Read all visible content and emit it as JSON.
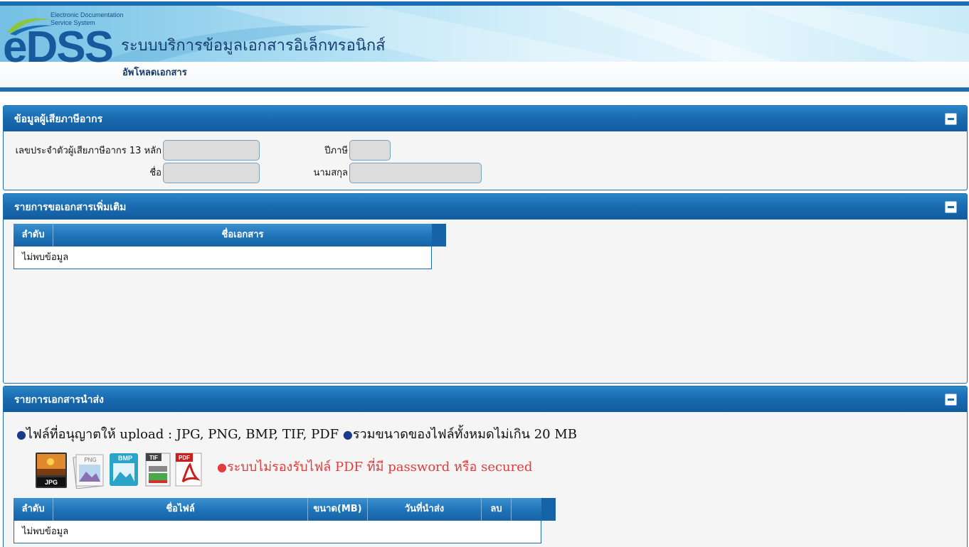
{
  "header": {
    "brand": "eDSS",
    "brand_sub": "Electronic Documentation Service System",
    "app_title": "ระบบบริการข้อมูลเอกสารอิเล็กทรอนิกส์",
    "page_subtitle": "อัพโหลดเอกสาร"
  },
  "taxpayer_panel": {
    "title": "ข้อมูลผู้เสียภาษีอากร",
    "tax_id_label": "เลขประจำตัวผู้เสียภาษีอากร 13 หลัก",
    "tax_id_value": "",
    "tax_year_label": "ปีภาษี",
    "tax_year_value": "",
    "first_name_label": "ชื่อ",
    "first_name_value": "",
    "last_name_label": "นามสกุล",
    "last_name_value": ""
  },
  "request_panel": {
    "title": "รายการขอเอกสารเพิ่มเติม",
    "columns": [
      "ลำดับ",
      "ชื่อเอกสาร"
    ],
    "empty_text": "ไม่พบข้อมูล"
  },
  "submit_panel": {
    "title": "รายการเอกสารนำส่ง",
    "allowed_note": "ไฟล์ที่อนุญาตให้ upload : JPG, PNG, BMP, TIF, PDF",
    "size_note": "รวมขนาดของไฟล์ทั้งหมดไม่เกิน 20 MB",
    "warning": "ระบบไม่รองรับไฟล์ PDF ที่มี password หรือ secured",
    "file_types": [
      "JPG",
      "PNG",
      "BMP",
      "TIF",
      "PDF"
    ],
    "columns": [
      "ลำดับ",
      "ชื่อไฟล์",
      "ขนาด(MB)",
      "วันที่นำส่ง",
      "ลบ"
    ],
    "empty_text": "ไม่พบข้อมูล"
  },
  "colors": {
    "primary": "#1b6db3",
    "header_gradient_top": "#2b87c8",
    "warning": "#e23b3b",
    "input_bg": "#dcdcdc"
  },
  "icons": [
    "collapse-icon",
    "jpg-file-icon",
    "png-file-icon",
    "bmp-file-icon",
    "tif-file-icon",
    "pdf-file-icon"
  ]
}
